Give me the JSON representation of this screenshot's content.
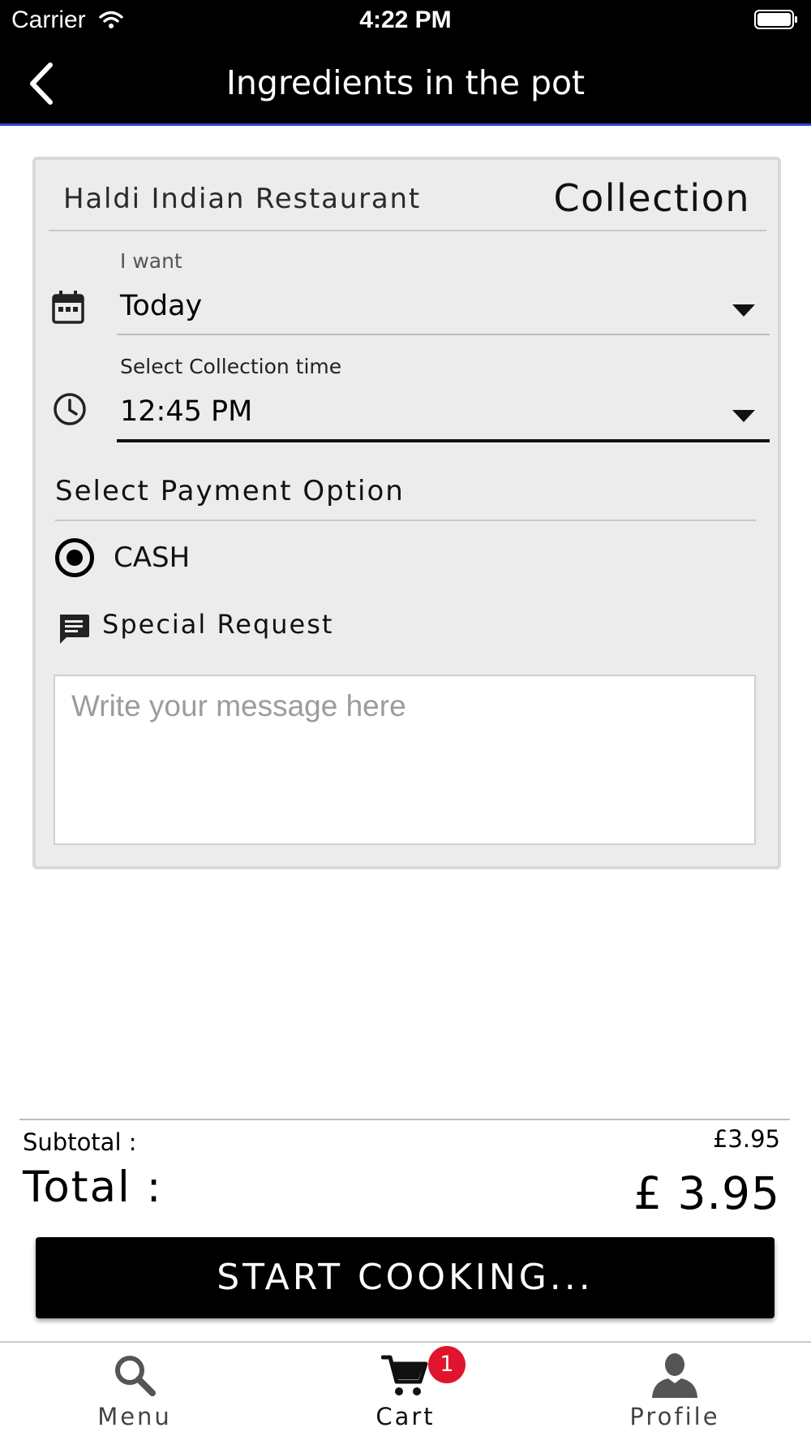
{
  "status_bar": {
    "carrier": "Carrier",
    "time": "4:22 PM"
  },
  "nav": {
    "title": "Ingredients in the pot",
    "back_icon": "chevron-left-icon"
  },
  "order": {
    "restaurant": "Haldi Indian Restaurant",
    "mode": "Collection",
    "i_want_label": "I want",
    "day_value": "Today",
    "time_label": "Select Collection time",
    "time_value": "12:45 PM",
    "payment_heading": "Select Payment Option",
    "payment_option": "CASH",
    "payment_selected": true,
    "special_request_label": "Special Request",
    "message_placeholder": "Write your message here"
  },
  "totals": {
    "subtotal_label": "Subtotal :",
    "subtotal_value": "£3.95",
    "total_label": "Total :",
    "total_value": "£ 3.95"
  },
  "cta": {
    "label": "START COOKING..."
  },
  "tabbar": {
    "items": [
      {
        "label": "Menu",
        "icon": "search-icon",
        "active": false
      },
      {
        "label": "Cart",
        "icon": "cart-icon",
        "active": true,
        "badge": "1"
      },
      {
        "label": "Profile",
        "icon": "user-icon",
        "active": false
      }
    ]
  },
  "colors": {
    "nav_bg": "#000000",
    "nav_underline": "#2b45d6",
    "badge": "#e0142c",
    "card_bg": "#ececec"
  }
}
